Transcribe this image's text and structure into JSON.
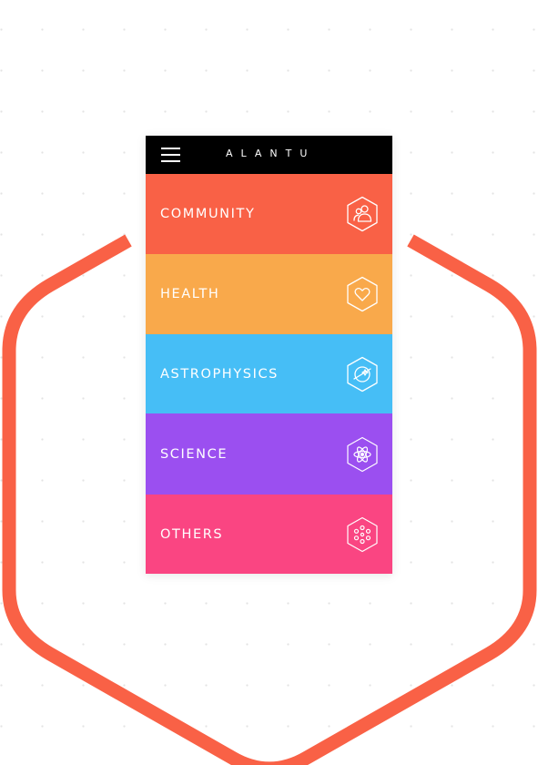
{
  "app": {
    "brand": "ALANTU"
  },
  "colors": {
    "accent_hexagon": "#f96146",
    "topbar": "#000000"
  },
  "menu": [
    {
      "label": "COMMUNITY",
      "icon": "community-icon",
      "color": "#f96146"
    },
    {
      "label": "HEALTH",
      "icon": "heart-icon",
      "color": "#f9a94b"
    },
    {
      "label": "ASTROPHYSICS",
      "icon": "planet-icon",
      "color": "#46bef6"
    },
    {
      "label": "SCIENCE",
      "icon": "atom-icon",
      "color": "#9b4ff0"
    },
    {
      "label": "OTHERS",
      "icon": "dots-icon",
      "color": "#fa4582"
    }
  ]
}
